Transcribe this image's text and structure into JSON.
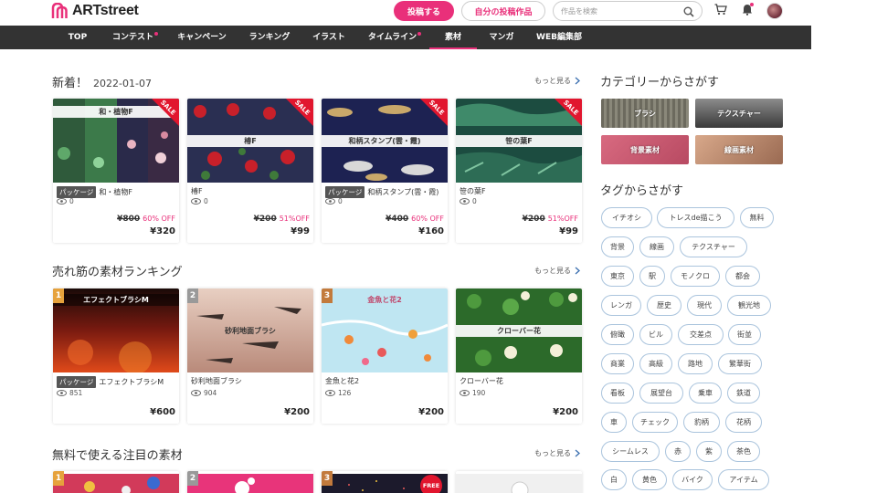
{
  "header": {
    "logo_text": "ARTstreet",
    "post_button": "投稿する",
    "my_posts_button": "自分の投稿作品",
    "search_placeholder": "作品を検索"
  },
  "nav": {
    "items": [
      {
        "label": "TOP"
      },
      {
        "label": "コンテスト",
        "dot": true
      },
      {
        "label": "キャンペーン"
      },
      {
        "label": "ランキング"
      },
      {
        "label": "イラスト"
      },
      {
        "label": "タイムライン",
        "dot": true
      },
      {
        "label": "素材",
        "active": true
      },
      {
        "label": "マンガ"
      },
      {
        "label": "WEB編集部"
      }
    ]
  },
  "colors": {
    "accent": "#e9307a",
    "nav_bg": "#333333",
    "sale": "#e1162e",
    "tag_border": "#aac4dd"
  },
  "new_section": {
    "title": "新着！",
    "date": "2022-01-07",
    "more": "もっと見る",
    "cards": [
      {
        "banner": "和・植物F",
        "sale": "SALE",
        "package": "パッケージ",
        "name": "和・植物F",
        "views": "0",
        "old_price": "¥800",
        "off": "60% OFF",
        "price": "¥320"
      },
      {
        "banner": "椿F",
        "sale": "SALE",
        "package": "",
        "name": "椿F",
        "views": "0",
        "old_price": "¥200",
        "off": "51%OFF",
        "price": "¥99"
      },
      {
        "banner": "和柄スタンプ(雲・霞)",
        "sale": "SALE",
        "package": "パッケージ",
        "name": "和柄スタンプ(雲・霞)",
        "views": "0",
        "old_price": "¥400",
        "off": "60% OFF",
        "price": "¥160"
      },
      {
        "banner": "笹の葉F",
        "sale": "SALE",
        "package": "",
        "name": "笹の葉F",
        "views": "0",
        "old_price": "¥200",
        "off": "51%OFF",
        "price": "¥99"
      }
    ]
  },
  "ranking_section": {
    "title": "売れ筋の素材ランキング",
    "more": "もっと見る",
    "cards": [
      {
        "rank": "1",
        "banner": "エフェクトブラシM",
        "package": "パッケージ",
        "name": "エフェクトブラシM",
        "views": "851",
        "price": "¥600"
      },
      {
        "rank": "2",
        "banner": "砂利地面ブラシ",
        "package": "",
        "name": "砂利地面ブラシ",
        "views": "904",
        "price": "¥200"
      },
      {
        "rank": "3",
        "banner": "金魚と花2",
        "package": "",
        "name": "金魚と花2",
        "views": "126",
        "price": "¥200"
      },
      {
        "rank": "",
        "banner": "クローバー花",
        "package": "",
        "name": "クローバー花",
        "views": "190",
        "price": "¥200"
      }
    ]
  },
  "free_section": {
    "title": "無料で使える注目の素材",
    "more": "もっと見る",
    "ranks": [
      "1",
      "2",
      "3"
    ],
    "free_badge": "FREE"
  },
  "sidebar": {
    "category_title": "カテゴリーからさがす",
    "categories": [
      "ブラシ",
      "テクスチャー",
      "背景素材",
      "線画素材"
    ],
    "tag_title": "タグからさがす",
    "tags": [
      "イチオシ",
      "トレスde描こう",
      "無料",
      "背景",
      "線画",
      "テクスチャー",
      "東京",
      "駅",
      "モノクロ",
      "都会",
      "レンガ",
      "歴史",
      "現代",
      "観光地",
      "俯瞰",
      "ビル",
      "交差点",
      "街並",
      "商業",
      "高級",
      "路地",
      "繁華街",
      "看板",
      "展望台",
      "乗車",
      "鉄道",
      "車",
      "チェック",
      "豹柄",
      "花柄",
      "シームレス",
      "赤",
      "紫",
      "茶色",
      "白",
      "黄色",
      "バイク",
      "アイテム"
    ]
  }
}
